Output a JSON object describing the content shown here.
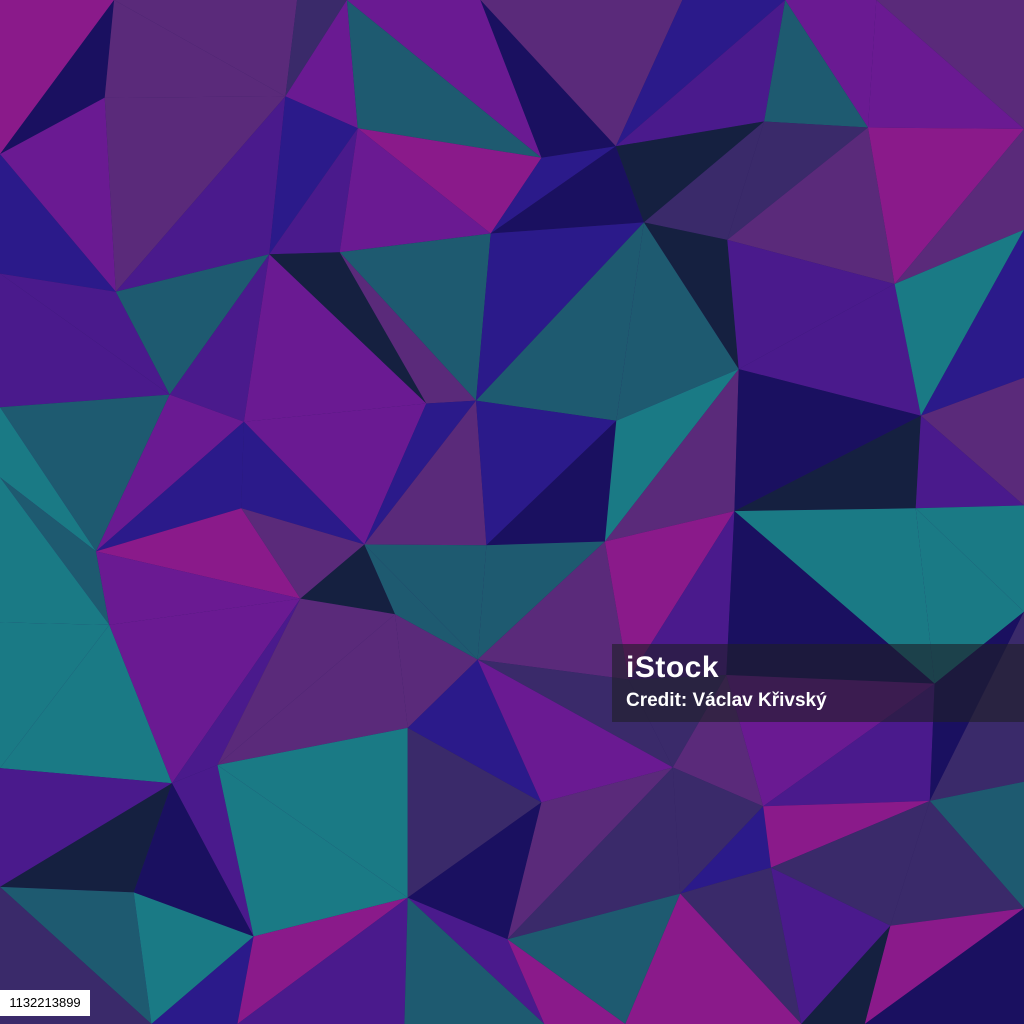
{
  "watermark": {
    "logo_text": "iStock",
    "credit_text": "Credit: Václav Křivský"
  },
  "image_id": "1132213899",
  "palette": [
    "#1a1060",
    "#2b1a8a",
    "#4a1a8c",
    "#6a1a92",
    "#8a1a8a",
    "#1e5a70",
    "#1a7a85",
    "#3a2a6a",
    "#152040",
    "#5a2a7a"
  ]
}
